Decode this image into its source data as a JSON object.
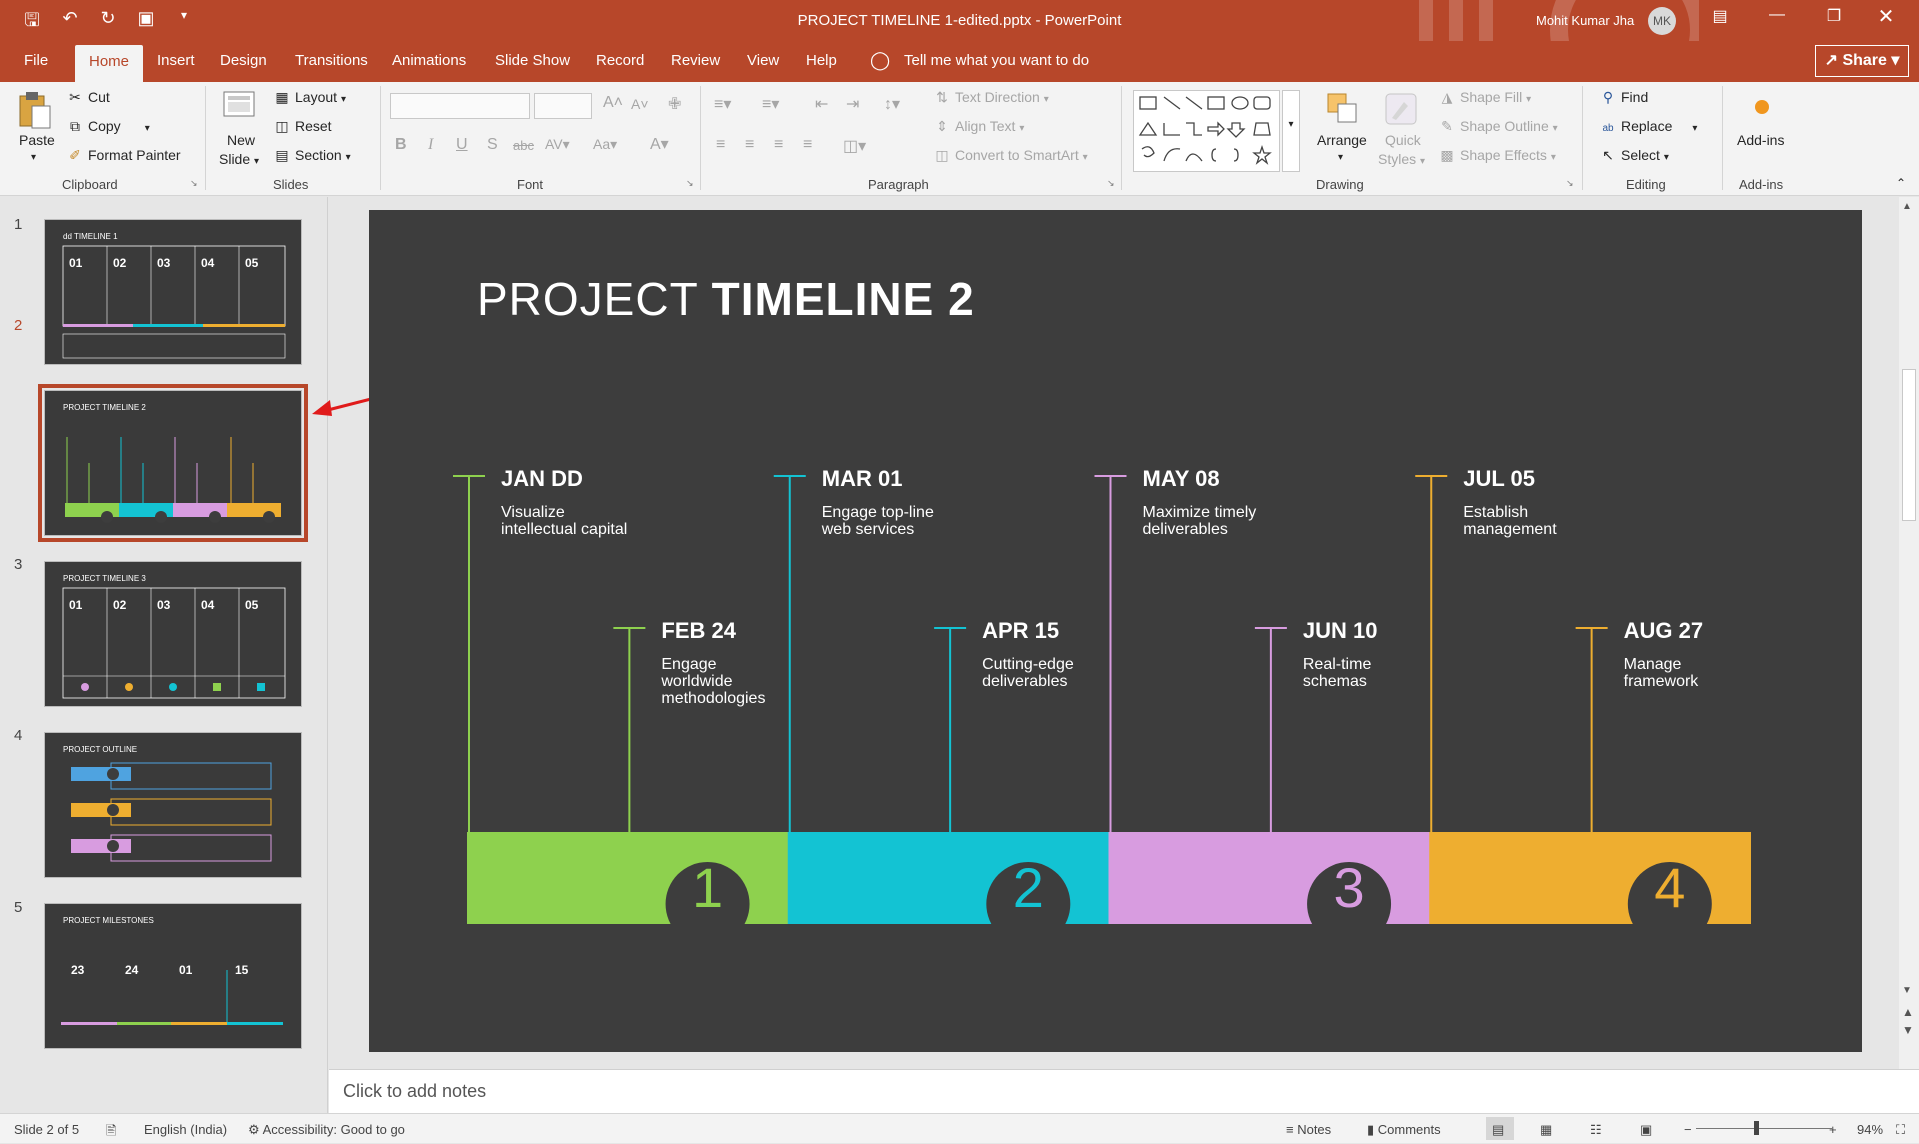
{
  "window": {
    "doc_title": "PROJECT TIMELINE 1-edited.pptx  -  PowerPoint",
    "user_name": "Mohit Kumar Jha",
    "avatar_initials": "MK"
  },
  "tabs": [
    "File",
    "Home",
    "Insert",
    "Design",
    "Transitions",
    "Animations",
    "Slide Show",
    "Record",
    "Review",
    "View",
    "Help"
  ],
  "tell_me": "Tell me what you want to do",
  "share": "Share",
  "ribbon": {
    "clipboard": {
      "paste": "Paste",
      "cut": "Cut",
      "copy": "Copy",
      "format_painter": "Format Painter",
      "label": "Clipboard"
    },
    "slides": {
      "new_slide_line1": "New",
      "new_slide_line2": "Slide",
      "layout": "Layout",
      "reset": "Reset",
      "section": "Section",
      "label": "Slides"
    },
    "font": {
      "label": "Font"
    },
    "paragraph": {
      "text_direction": "Text Direction",
      "align_text": "Align Text",
      "convert": "Convert to SmartArt",
      "label": "Paragraph"
    },
    "drawing": {
      "arrange": "Arrange",
      "quick_styles_1": "Quick",
      "quick_styles_2": "Styles",
      "shape_fill": "Shape Fill",
      "shape_outline": "Shape Outline",
      "shape_effects": "Shape Effects",
      "label": "Drawing"
    },
    "editing": {
      "find": "Find",
      "replace": "Replace",
      "select": "Select",
      "label": "Editing"
    },
    "addins": {
      "addins": "Add-ins",
      "label": "Add-ins"
    }
  },
  "thumbnails": [
    {
      "num": "1",
      "title": "dd TIMELINE 1"
    },
    {
      "num": "2",
      "title": "PROJECT TIMELINE 2"
    },
    {
      "num": "3",
      "title": "PROJECT TIMELINE 3"
    },
    {
      "num": "4",
      "title": "PROJECT OUTLINE"
    },
    {
      "num": "5",
      "title": "PROJECT MILESTONES"
    }
  ],
  "slide": {
    "title_light": "PROJECT ",
    "title_bold": "TIMELINE 2",
    "milestones": [
      {
        "date": "JAN DD",
        "desc": "Visualize intellectual capital",
        "color": "#8ed14e"
      },
      {
        "date": "FEB 24",
        "desc": "Engage worldwide methodologies",
        "color": "#8ed14e"
      },
      {
        "date": "MAR 01",
        "desc": "Engage top-line web services",
        "color": "#13c3d3"
      },
      {
        "date": "APR 15",
        "desc": "Cutting-edge deliverables",
        "color": "#13c3d3"
      },
      {
        "date": "MAY 08",
        "desc": "Maximize timely deliverables",
        "color": "#d89ce0"
      },
      {
        "date": "JUN 10",
        "desc": "Real-time schemas",
        "color": "#d89ce0"
      },
      {
        "date": "JUL 05",
        "desc": "Establish management",
        "color": "#eeae30"
      },
      {
        "date": "AUG 27",
        "desc": "Manage framework",
        "color": "#eeae30"
      }
    ],
    "phases": [
      {
        "num": "1",
        "color": "#8ed14e"
      },
      {
        "num": "2",
        "color": "#13c3d3"
      },
      {
        "num": "3",
        "color": "#d89ce0"
      },
      {
        "num": "4",
        "color": "#eeae30"
      }
    ]
  },
  "notes_placeholder": "Click to add notes",
  "status": {
    "slide": "Slide 2 of 5",
    "language": "English (India)",
    "accessibility": "Accessibility: Good to go",
    "notes": "Notes",
    "comments": "Comments",
    "zoom": "94%"
  },
  "colors": {
    "accent": "#b7472a",
    "slide_bg": "#3d3d3d"
  }
}
